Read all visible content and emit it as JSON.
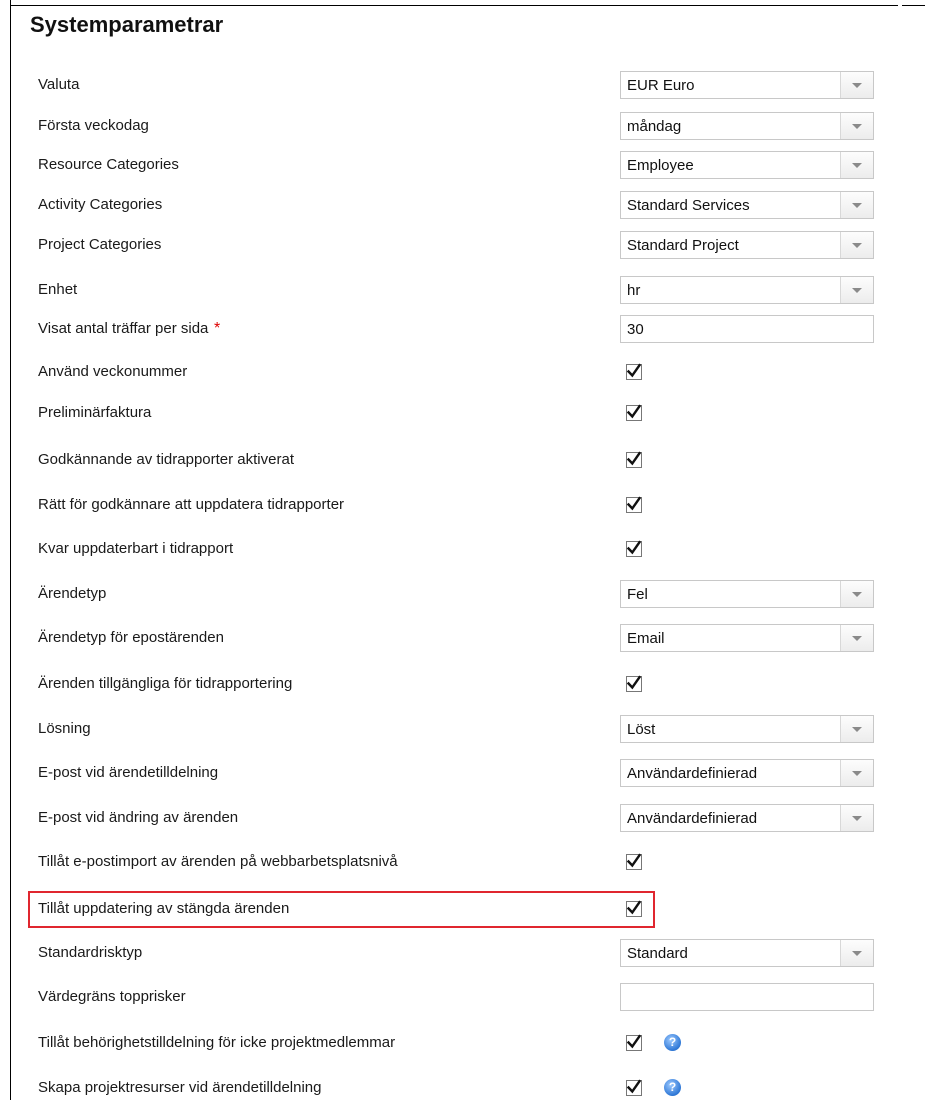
{
  "page": {
    "title": "Systemparametrar"
  },
  "rows": [
    {
      "label": "Valuta",
      "type": "select",
      "value": "EUR Euro"
    },
    {
      "label": "Första veckodag",
      "type": "select",
      "value": "måndag"
    },
    {
      "label": "Resource Categories",
      "type": "select",
      "value": "Employee"
    },
    {
      "label": "Activity Categories",
      "type": "select",
      "value": "Standard Services"
    },
    {
      "label": "Project Categories",
      "type": "select",
      "value": "Standard Project"
    },
    {
      "label": "Enhet",
      "type": "select",
      "value": "hr"
    },
    {
      "label": "Visat antal träffar per sida",
      "type": "text",
      "value": "30",
      "required": true,
      "required_mark": "*"
    },
    {
      "label": "Använd veckonummer",
      "type": "checkbox",
      "checked": true
    },
    {
      "label": "Preliminärfaktura",
      "type": "checkbox",
      "checked": true
    },
    {
      "label": "Godkännande av tidrapporter aktiverat",
      "type": "checkbox",
      "checked": true
    },
    {
      "label": "Rätt för godkännare att uppdatera tidrapporter",
      "type": "checkbox",
      "checked": true
    },
    {
      "label": "Kvar uppdaterbart i tidrapport",
      "type": "checkbox",
      "checked": true
    },
    {
      "label": "Ärendetyp",
      "type": "select",
      "value": "Fel"
    },
    {
      "label": "Ärendetyp för epostärenden",
      "type": "select",
      "value": "Email"
    },
    {
      "label": "Ärenden tillgängliga för tidrapportering",
      "type": "checkbox",
      "checked": true
    },
    {
      "label": "Lösning",
      "type": "select",
      "value": "Löst"
    },
    {
      "label": "E-post vid ärendetilldelning",
      "type": "select",
      "value": "Användardefinierad"
    },
    {
      "label": "E-post vid ändring av ärenden",
      "type": "select",
      "value": "Användardefinierad"
    },
    {
      "label": "Tillåt e-postimport av ärenden på webbarbetsplatsnivå",
      "type": "checkbox",
      "checked": true
    },
    {
      "label": "Tillåt uppdatering av stängda ärenden",
      "type": "checkbox",
      "checked": true,
      "highlighted": true
    },
    {
      "label": "Standardrisktyp",
      "type": "select",
      "value": "Standard"
    },
    {
      "label": "Värdegräns topprisker",
      "type": "text",
      "value": ""
    },
    {
      "label": "Tillåt behörighetstilldelning för icke projektmedlemmar",
      "type": "checkbox",
      "checked": true,
      "help": true,
      "help_icon": "question-circle-icon"
    },
    {
      "label": "Skapa projektresurser vid ärendetilldelning",
      "type": "checkbox",
      "checked": true,
      "help": true,
      "help_icon": "question-circle-icon"
    }
  ],
  "colors": {
    "highlight_border": "#e0262f",
    "required_mark": "#dd0000",
    "help_icon": "#2f78d6"
  }
}
